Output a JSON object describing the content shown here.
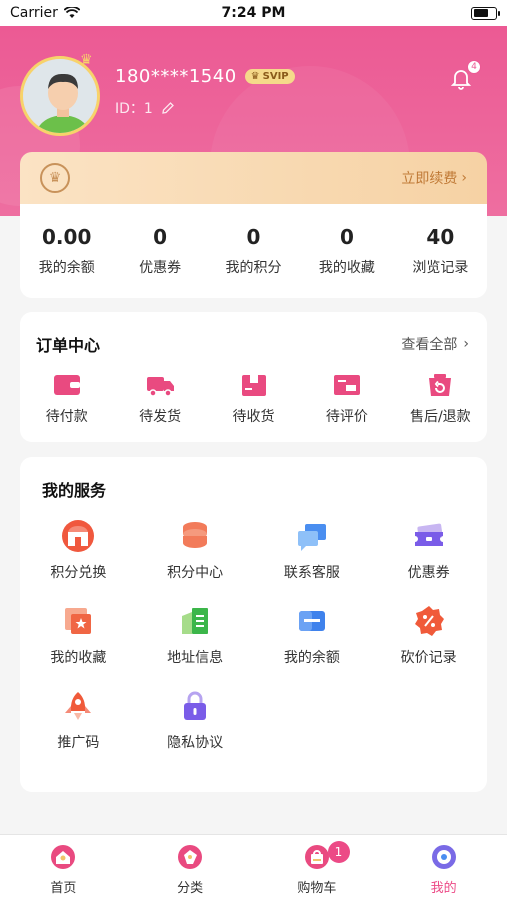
{
  "status_bar": {
    "carrier": "Carrier",
    "time": "7:24 PM"
  },
  "profile": {
    "username": "180****1540",
    "vip_badge": "SVIP",
    "user_id": "ID：1",
    "notification_count": "4"
  },
  "vip_bar": {
    "renew_label": "立即续费"
  },
  "stats": [
    {
      "value": "0.00",
      "label": "我的余额"
    },
    {
      "value": "0",
      "label": "优惠券"
    },
    {
      "value": "0",
      "label": "我的积分"
    },
    {
      "value": "0",
      "label": "我的收藏"
    },
    {
      "value": "40",
      "label": "浏览记录"
    }
  ],
  "orders": {
    "title": "订单中心",
    "view_all": "查看全部",
    "items": [
      {
        "label": "待付款",
        "icon": "wallet-icon"
      },
      {
        "label": "待发货",
        "icon": "truck-icon"
      },
      {
        "label": "待收货",
        "icon": "box-icon"
      },
      {
        "label": "待评价",
        "icon": "review-icon"
      },
      {
        "label": "售后/退款",
        "icon": "refund-icon"
      }
    ]
  },
  "services": {
    "title": "我的服务",
    "items": [
      {
        "label": "积分兑换",
        "icon": "exchange-store-icon"
      },
      {
        "label": "积分中心",
        "icon": "coins-stack-icon"
      },
      {
        "label": "联系客服",
        "icon": "chat-icon"
      },
      {
        "label": "优惠券",
        "icon": "ticket-icon"
      },
      {
        "label": "我的收藏",
        "icon": "favorite-icon"
      },
      {
        "label": "地址信息",
        "icon": "address-book-icon"
      },
      {
        "label": "我的余额",
        "icon": "card-icon"
      },
      {
        "label": "砍价记录",
        "icon": "discount-icon"
      },
      {
        "label": "推广码",
        "icon": "rocket-icon"
      },
      {
        "label": "隐私协议",
        "icon": "lock-icon"
      }
    ]
  },
  "tabbar": {
    "cart_badge": "1",
    "items": [
      {
        "label": "首页",
        "icon": "home-icon"
      },
      {
        "label": "分类",
        "icon": "category-icon"
      },
      {
        "label": "购物车",
        "icon": "cart-icon"
      },
      {
        "label": "我的",
        "icon": "profile-icon"
      }
    ]
  },
  "colors": {
    "brand": "#ec5a94",
    "active_tab": "#ec4a86",
    "vip_gold": "#c07a36"
  }
}
